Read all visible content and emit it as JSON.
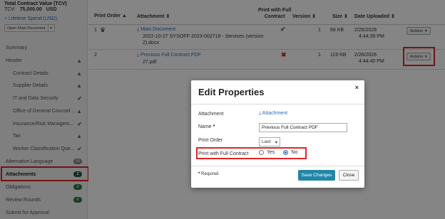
{
  "sidebar": {
    "tcv_title": "Total Contract Value (TCV)",
    "tcv_label": "TCV:",
    "tcv_value": "75,000.00",
    "tcv_currency": "USD",
    "lifetime_link": "+ Lifetime Spend (USD)",
    "open_main_document": "Open Main Document",
    "items": [
      {
        "label": "Summary",
        "status": ""
      },
      {
        "label": "Header",
        "status": "warn"
      },
      {
        "label": "Contract Details",
        "status": "warn"
      },
      {
        "label": "Supplier Details",
        "status": "warn"
      },
      {
        "label": "IT and Data Security",
        "status": "ok"
      },
      {
        "label": "Office of General Counsel ...",
        "status": "warn"
      },
      {
        "label": "Insurance/Risk Managem...",
        "status": "ok"
      },
      {
        "label": "Tax",
        "status": "warn"
      },
      {
        "label": "Worker Classification Que...",
        "status": "ok"
      },
      {
        "label": "Alternative Language",
        "badge": "16"
      },
      {
        "label": "Attachments",
        "badge": "2"
      },
      {
        "label": "Obligations",
        "badge": "0"
      },
      {
        "label": "Review Rounds",
        "badge": "0"
      },
      {
        "label": "Submit for Approval",
        "badge": ""
      }
    ]
  },
  "table": {
    "headers": {
      "print_order": "Print Order",
      "attachment": "Attachment",
      "print_with_full_contract_1": "Print with Full",
      "print_with_full_contract_2": "Contract",
      "version": "Version",
      "size": "Size",
      "date_uploaded": "Date Uploaded"
    },
    "rows": [
      {
        "order": "1",
        "name": "Main Document",
        "detail_1": "2022-10-27 SYSOFF-2023-002718 - Services (version",
        "detail_2": "2).docx",
        "version": "1",
        "size": "68 KB",
        "date": "2/26/2026",
        "time": "4:44:39 PM",
        "actions": "Actions"
      },
      {
        "order": "2",
        "name": "Previous Full Contract PDF",
        "detail_1": "27.pdf",
        "detail_2": "",
        "version": "1",
        "size": "119 KB",
        "date": "2/26/2026",
        "time": "4:44:40 PM",
        "actions": "Actions"
      }
    ]
  },
  "modal": {
    "title": "Edit Properties",
    "close_symbol": "×",
    "attachment_label": "Attachment",
    "attachment_link": "Attachment",
    "name_label": "Name",
    "required_mark": "*",
    "name_value": "Previous Full Contract PDF",
    "print_order_label": "Print Order",
    "print_order_value": "Last",
    "print_full_label": "Print with Full Contract",
    "yes_label": "Yes",
    "no_label": "No",
    "required_note": "Required",
    "save_label": "Save Changes",
    "close_label": "Close"
  },
  "colors": {
    "highlight": "#e32424",
    "link": "#2a6db5",
    "save": "#2186a8",
    "check": "#2e8b3a",
    "cross": "#c0302a"
  }
}
